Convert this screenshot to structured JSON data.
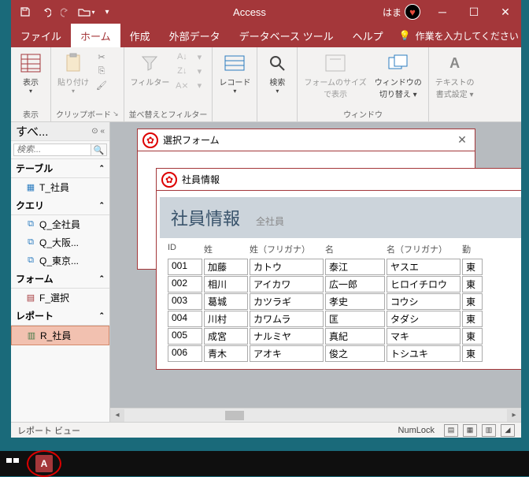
{
  "titlebar": {
    "app_title": "Access",
    "user_name": "はま"
  },
  "menu": {
    "file": "ファイル",
    "home": "ホーム",
    "create": "作成",
    "external": "外部データ",
    "dbtools": "データベース ツール",
    "help": "ヘルプ",
    "tellme": "作業を入力してください"
  },
  "ribbon": {
    "view": {
      "label": "表示",
      "group": "表示"
    },
    "clipboard": {
      "paste": "貼り付け",
      "group": "クリップボード"
    },
    "sort": {
      "filter": "フィルター",
      "group": "並べ替えとフィルター"
    },
    "records": {
      "record": "レコード",
      "group": ""
    },
    "find": {
      "search": "検索",
      "group": ""
    },
    "window": {
      "formsize": "フォームのサイズ\nで表示",
      "switch": "ウィンドウの\n切り替え ▾",
      "group": "ウィンドウ"
    },
    "textfmt": {
      "label": "テキストの\n書式設定 ▾",
      "group": ""
    }
  },
  "nav": {
    "title": "すべ...",
    "search_placeholder": "検索...",
    "groups": {
      "tables": "テーブル",
      "queries": "クエリ",
      "forms": "フォーム",
      "reports": "レポート"
    },
    "items": {
      "t_emp": "T_社員",
      "q_all": "Q_全社員",
      "q_osaka": "Q_大阪...",
      "q_tokyo": "Q_東京...",
      "f_select": "F_選択",
      "r_emp": "R_社員"
    }
  },
  "form1": {
    "title": "選択フォーム"
  },
  "form2": {
    "title": "社員情報"
  },
  "report": {
    "title": "社員情報",
    "subtitle": "全社員",
    "columns": {
      "id": "ID",
      "sei": "姓",
      "seik": "姓（フリガナ）",
      "mei": "名",
      "meik": "名（フリガナ）",
      "office": "勤"
    },
    "rows": [
      {
        "id": "001",
        "sei": "加藤",
        "seik": "カトウ",
        "mei": "泰江",
        "meik": "ヤスエ",
        "office": "東"
      },
      {
        "id": "002",
        "sei": "相川",
        "seik": "アイカワ",
        "mei": "広一郎",
        "meik": "ヒロイチロウ",
        "office": "東"
      },
      {
        "id": "003",
        "sei": "葛城",
        "seik": "カツラギ",
        "mei": "孝史",
        "meik": "コウシ",
        "office": "東"
      },
      {
        "id": "004",
        "sei": "川村",
        "seik": "カワムラ",
        "mei": "匡",
        "meik": "タダシ",
        "office": "東"
      },
      {
        "id": "005",
        "sei": "成宮",
        "seik": "ナルミヤ",
        "mei": "真紀",
        "meik": "マキ",
        "office": "東"
      },
      {
        "id": "006",
        "sei": "青木",
        "seik": "アオキ",
        "mei": "俊之",
        "meik": "トシユキ",
        "office": "東"
      }
    ]
  },
  "status": {
    "view": "レポート ビュー",
    "numlock": "NumLock"
  }
}
